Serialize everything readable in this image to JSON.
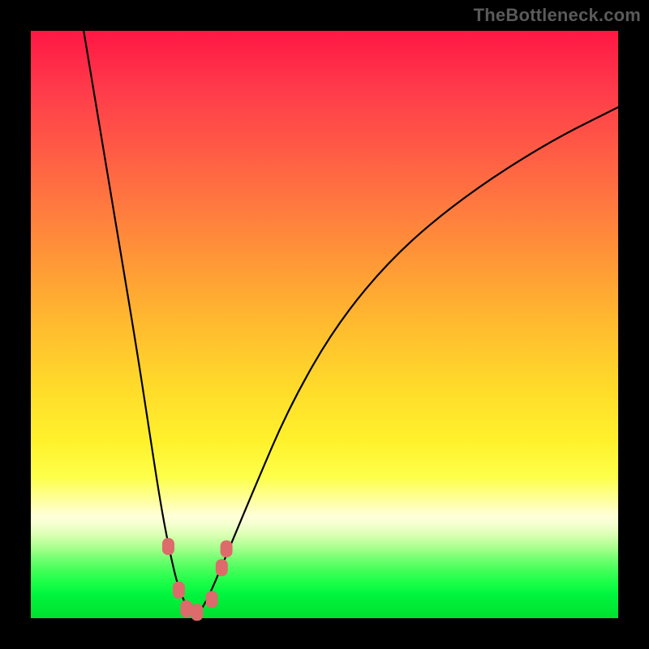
{
  "watermark": "TheBottleneck.com",
  "chart_data": {
    "type": "line",
    "title": "",
    "xlabel": "",
    "ylabel": "",
    "x_range": [
      0,
      100
    ],
    "y_range": [
      0,
      100
    ],
    "grid": false,
    "legend": false,
    "series": [
      {
        "name": "left-branch",
        "x": [
          9,
          12,
          15,
          18,
          20,
          22,
          23.5,
          25,
          26.5,
          28
        ],
        "y": [
          100,
          82,
          64,
          46,
          33,
          20,
          12,
          5.5,
          2,
          0
        ]
      },
      {
        "name": "right-branch",
        "x": [
          28,
          30,
          33,
          38,
          44,
          52,
          62,
          74,
          88,
          100
        ],
        "y": [
          0,
          3,
          10,
          22,
          36,
          50,
          62,
          72,
          81,
          87
        ]
      }
    ],
    "markers": [
      {
        "name": "marker-left-upper",
        "x": 23.4,
        "y": 12.2
      },
      {
        "name": "marker-left-lower",
        "x": 25.2,
        "y": 4.8
      },
      {
        "name": "marker-vertex-1",
        "x": 26.5,
        "y": 1.6
      },
      {
        "name": "marker-vertex-2",
        "x": 28.3,
        "y": 1.0
      },
      {
        "name": "marker-right-lower",
        "x": 30.8,
        "y": 3.2
      },
      {
        "name": "marker-right-upper",
        "x": 32.5,
        "y": 8.6
      },
      {
        "name": "marker-right-top",
        "x": 33.3,
        "y": 11.8
      }
    ],
    "colors": {
      "curve": "#000000",
      "marker_fill": "#dd6b6b",
      "gradient_top": "#ff1744",
      "gradient_bottom": "#00e030"
    }
  }
}
